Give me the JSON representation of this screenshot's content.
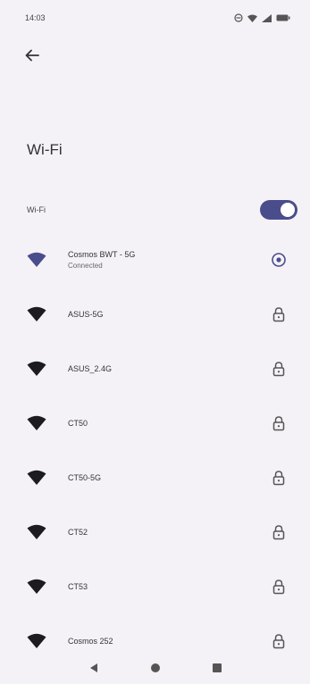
{
  "status_bar": {
    "time": "14:03"
  },
  "header": {
    "title": "Wi-Fi"
  },
  "wifi_toggle": {
    "label": "Wi-Fi",
    "enabled": true
  },
  "networks": [
    {
      "name": "Cosmos BWT - 5G",
      "status": "Connected",
      "connected": true
    },
    {
      "name": "ASUS-5G",
      "status": "",
      "connected": false
    },
    {
      "name": "ASUS_2.4G",
      "status": "",
      "connected": false
    },
    {
      "name": "CT50",
      "status": "",
      "connected": false
    },
    {
      "name": "CT50-5G",
      "status": "",
      "connected": false
    },
    {
      "name": "CT52",
      "status": "",
      "connected": false
    },
    {
      "name": "CT53",
      "status": "",
      "connected": false
    },
    {
      "name": "Cosmos 252",
      "status": "",
      "connected": false
    }
  ],
  "colors": {
    "accent": "#4a4d8c",
    "background": "#f5f2f7",
    "icon_dark": "#1c1b1f",
    "icon_connected": "#4a4d8c"
  },
  "icons": {
    "back": "arrow-left-icon",
    "secured": "lock-icon",
    "connected": "settings-gear-icon"
  }
}
